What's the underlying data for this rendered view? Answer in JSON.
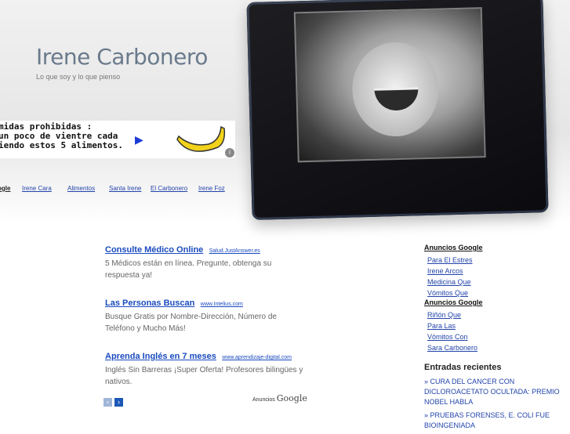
{
  "blog": {
    "title": "Irene Carbonero",
    "tagline": "Lo que soy y lo que pienso"
  },
  "banner": {
    "text": "midas prohibidas :\nun poco de vientre cada\niendo estos 5 alimentos.",
    "play_icon": "play-icon",
    "info_icon": "adchoices-icon"
  },
  "linkbar": [
    "ogle",
    "Irene Cara",
    "Alimentos",
    "Santa Irene",
    "El Carbonero",
    "Irene Foz"
  ],
  "ads": [
    {
      "title": "Consulte Médico Online",
      "url": "Salud.JustAnswer.es",
      "desc": "5 Médicos están en línea. Pregunte, obtenga su respuesta ya!"
    },
    {
      "title": "Las Personas Buscan",
      "url": "www.Intelius.com",
      "desc": "Busque Gratis por Nombre-Dirección, Número de Teléfono y Mucho Más!"
    },
    {
      "title": "Aprenda Inglés en 7 meses",
      "url": "www.aprendizaje-digital.com",
      "desc": "Inglés Sin Barreras ¡Super Oferta! Profesores bilingües y nativos."
    }
  ],
  "pager": {
    "prev": "‹",
    "next": "›"
  },
  "ads_by": {
    "prefix": "Anuncios",
    "brand": "Google"
  },
  "sidebar": {
    "group1": {
      "heading": "Anuncios Google",
      "links": [
        "Para El Estres",
        "Irene Arcos",
        "Medicina Que",
        "Vómitos Que"
      ]
    },
    "group2": {
      "heading": "Anuncios Google",
      "links": [
        "Riñón Que",
        "Para Las",
        "Vómitos Con",
        "Sara Carbonero"
      ]
    },
    "recent_title": "Entradas recientes",
    "recent": [
      "» CURA DEL CANCER CON DICLOROACETATO OCULTADA: PREMIO NOBEL HABLA",
      "» PRUEBAS FORENSES, E. COLI FUE BIOINGENIADA"
    ]
  },
  "colors": {
    "link": "#1a4bbf",
    "title": "#6a7a8c",
    "pager_active": "#1b57b7"
  }
}
